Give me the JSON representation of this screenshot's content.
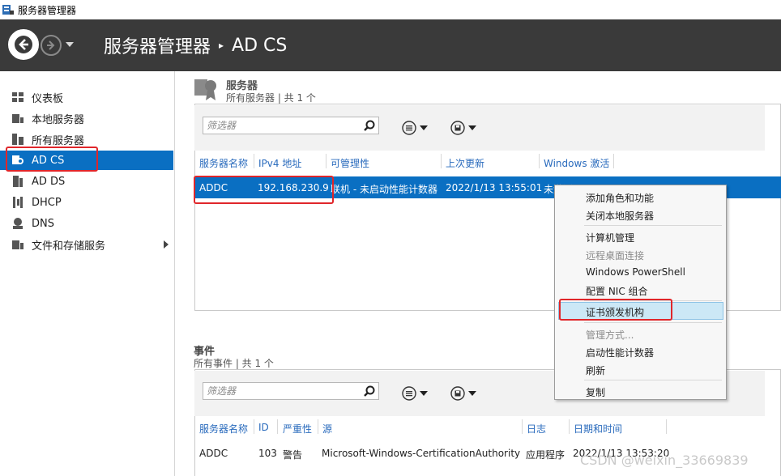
{
  "window": {
    "title": "服务器管理器"
  },
  "header": {
    "app": "服务器管理器",
    "separator": "▸",
    "current": "AD CS"
  },
  "sidebar": {
    "items": [
      {
        "label": "仪表板",
        "icon": "dashboard-icon"
      },
      {
        "label": "本地服务器",
        "icon": "local-server-icon"
      },
      {
        "label": "所有服务器",
        "icon": "all-servers-icon"
      },
      {
        "label": "AD CS",
        "icon": "adcs-icon",
        "active": true
      },
      {
        "label": "AD DS",
        "icon": "adds-icon"
      },
      {
        "label": "DHCP",
        "icon": "dhcp-icon"
      },
      {
        "label": "DNS",
        "icon": "dns-icon"
      },
      {
        "label": "文件和存储服务",
        "icon": "file-storage-icon",
        "has_children": true
      }
    ]
  },
  "servers": {
    "title": "服务器",
    "subtitle": "所有服务器 | 共 1 个",
    "filter_placeholder": "筛选器",
    "columns": [
      "服务器名称",
      "IPv4 地址",
      "可管理性",
      "上次更新",
      "Windows 激活"
    ],
    "row": {
      "name": "ADDC",
      "ip": "192.168.230.9",
      "manageability": "联机 - 未启动性能计数器",
      "last_update": "2022/1/13 13:55:01",
      "activation": "未激活"
    }
  },
  "events": {
    "title": "事件",
    "subtitle": "所有事件 | 共 1 个",
    "filter_placeholder": "筛选器",
    "columns": [
      "服务器名称",
      "ID",
      "严重性",
      "源",
      "日志",
      "日期和时间"
    ],
    "row": {
      "server": "ADDC",
      "id": "103",
      "severity": "警告",
      "source": "Microsoft-Windows-CertificationAuthority",
      "log": "应用程序",
      "datetime": "2022/1/13 13:53:20"
    }
  },
  "context_menu": {
    "items": [
      {
        "label": "添加角色和功能",
        "enabled": true
      },
      {
        "label": "关闭本地服务器",
        "enabled": true
      },
      {
        "label": "计算机管理",
        "enabled": true
      },
      {
        "label": "远程桌面连接",
        "enabled": false
      },
      {
        "label": "Windows PowerShell",
        "enabled": true
      },
      {
        "label": "配置 NIC 组合",
        "enabled": true
      },
      {
        "label": "证书颁发机构",
        "enabled": true,
        "highlighted": true
      },
      {
        "label": "管理方式...",
        "enabled": false
      },
      {
        "label": "启动性能计数器",
        "enabled": true
      },
      {
        "label": "刷新",
        "enabled": true
      },
      {
        "label": "复制",
        "enabled": true
      }
    ]
  },
  "watermark": "CSDN @weixin_33669839",
  "colors": {
    "header_bg": "#3a3a3a",
    "selection": "#0a6fc2",
    "link": "#2a6bbd",
    "annotation_red": "#e0262a"
  }
}
